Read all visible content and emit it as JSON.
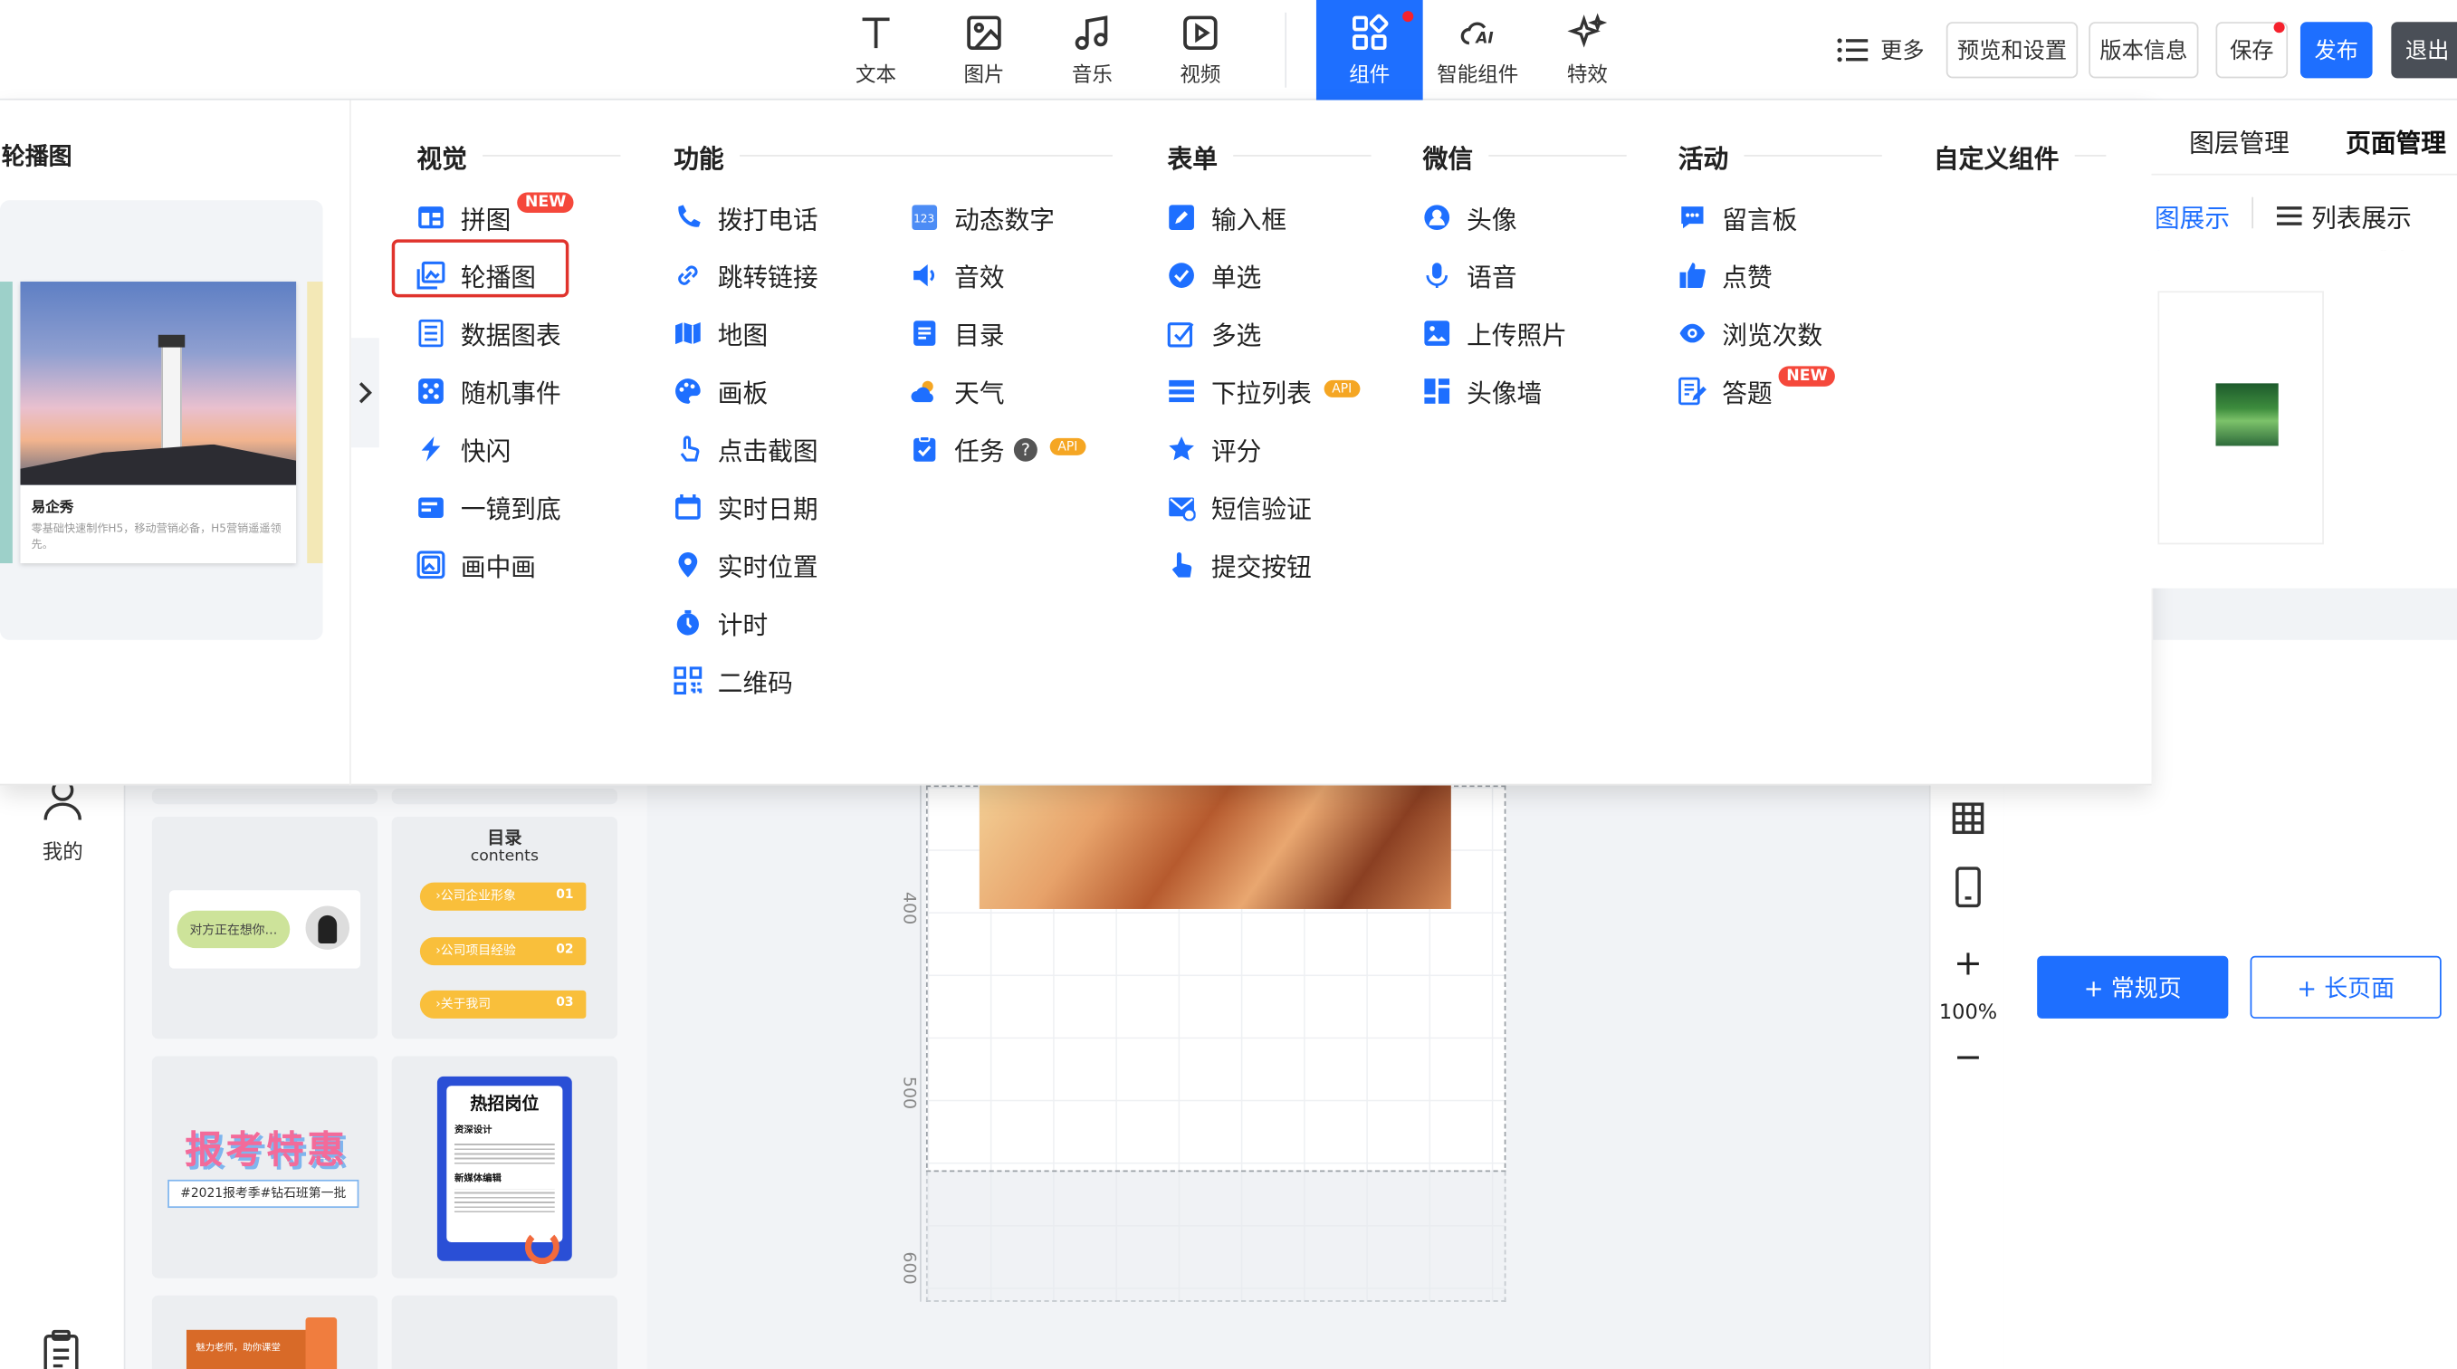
{
  "toolbar": {
    "items": [
      {
        "label": "文本",
        "icon": "text-icon"
      },
      {
        "label": "图片",
        "icon": "image-icon"
      },
      {
        "label": "音乐",
        "icon": "music-icon"
      },
      {
        "label": "视频",
        "icon": "video-icon"
      },
      {
        "label": "组件",
        "icon": "components-icon"
      },
      {
        "label": "智能组件",
        "icon": "ai-icon"
      },
      {
        "label": "特效",
        "icon": "sparkle-icon"
      }
    ],
    "more": "更多",
    "preview": "预览和设置",
    "version": "版本信息",
    "save": "保存",
    "publish": "发布",
    "exit": "退出"
  },
  "leftnav": {
    "mine": "我的"
  },
  "preview_panel": {
    "title": "轮播图",
    "card_title": "易企秀",
    "card_desc": "零基础快速制作H5，移动营销必备，H5营销遥遥领先。"
  },
  "library": {
    "chat_text": "对方正在想你…",
    "menu_title": "目录",
    "menu_sub": "contents",
    "menu_items": [
      "公司企业形象",
      "公司项目经验",
      "关于我司"
    ],
    "menu_nums": [
      "01",
      "02",
      "03"
    ],
    "promo_big": "报考特惠",
    "promo_tag": "#2021报考季#钻石班第一批",
    "job_title": "热招岗位",
    "job_sub1": "资深设计",
    "job_sub2": "新媒体编辑",
    "gift_text": "魅力老师，助你课堂"
  },
  "canvas": {
    "ruler": [
      "400",
      "500",
      "600"
    ]
  },
  "tools": {
    "zoom": "100%"
  },
  "rpanel": {
    "tab_layers": "图层管理",
    "tab_pages": "页面管理",
    "view_grid": "图展示",
    "view_list": "列表展示",
    "add_normal": "+ 常规页",
    "add_long": "+ 长页面"
  },
  "dropdown": {
    "columns": {
      "visual": "视觉",
      "function": "功能",
      "form": "表单",
      "wechat": "微信",
      "activity": "活动",
      "custom": "自定义组件"
    },
    "visual": [
      "拼图",
      "轮播图",
      "数据图表",
      "随机事件",
      "快闪",
      "一镜到底",
      "画中画"
    ],
    "function_a": [
      "拨打电话",
      "跳转链接",
      "地图",
      "画板",
      "点击截图",
      "实时日期",
      "实时位置",
      "计时",
      "二维码"
    ],
    "function_b": [
      "动态数字",
      "音效",
      "目录",
      "天气",
      "任务"
    ],
    "form": [
      "输入框",
      "单选",
      "多选",
      "下拉列表",
      "评分",
      "短信验证",
      "提交按钮"
    ],
    "wechat": [
      "头像",
      "语音",
      "上传照片",
      "头像墙"
    ],
    "activity": [
      "留言板",
      "点赞",
      "浏览次数",
      "答题"
    ],
    "badge_new": "NEW",
    "badge_api": "API",
    "help": "?"
  },
  "colors": {
    "accent": "#1e6fff",
    "new_badge": "#f5483b",
    "api_badge": "#f5a623",
    "highlight": "#e0332c"
  }
}
